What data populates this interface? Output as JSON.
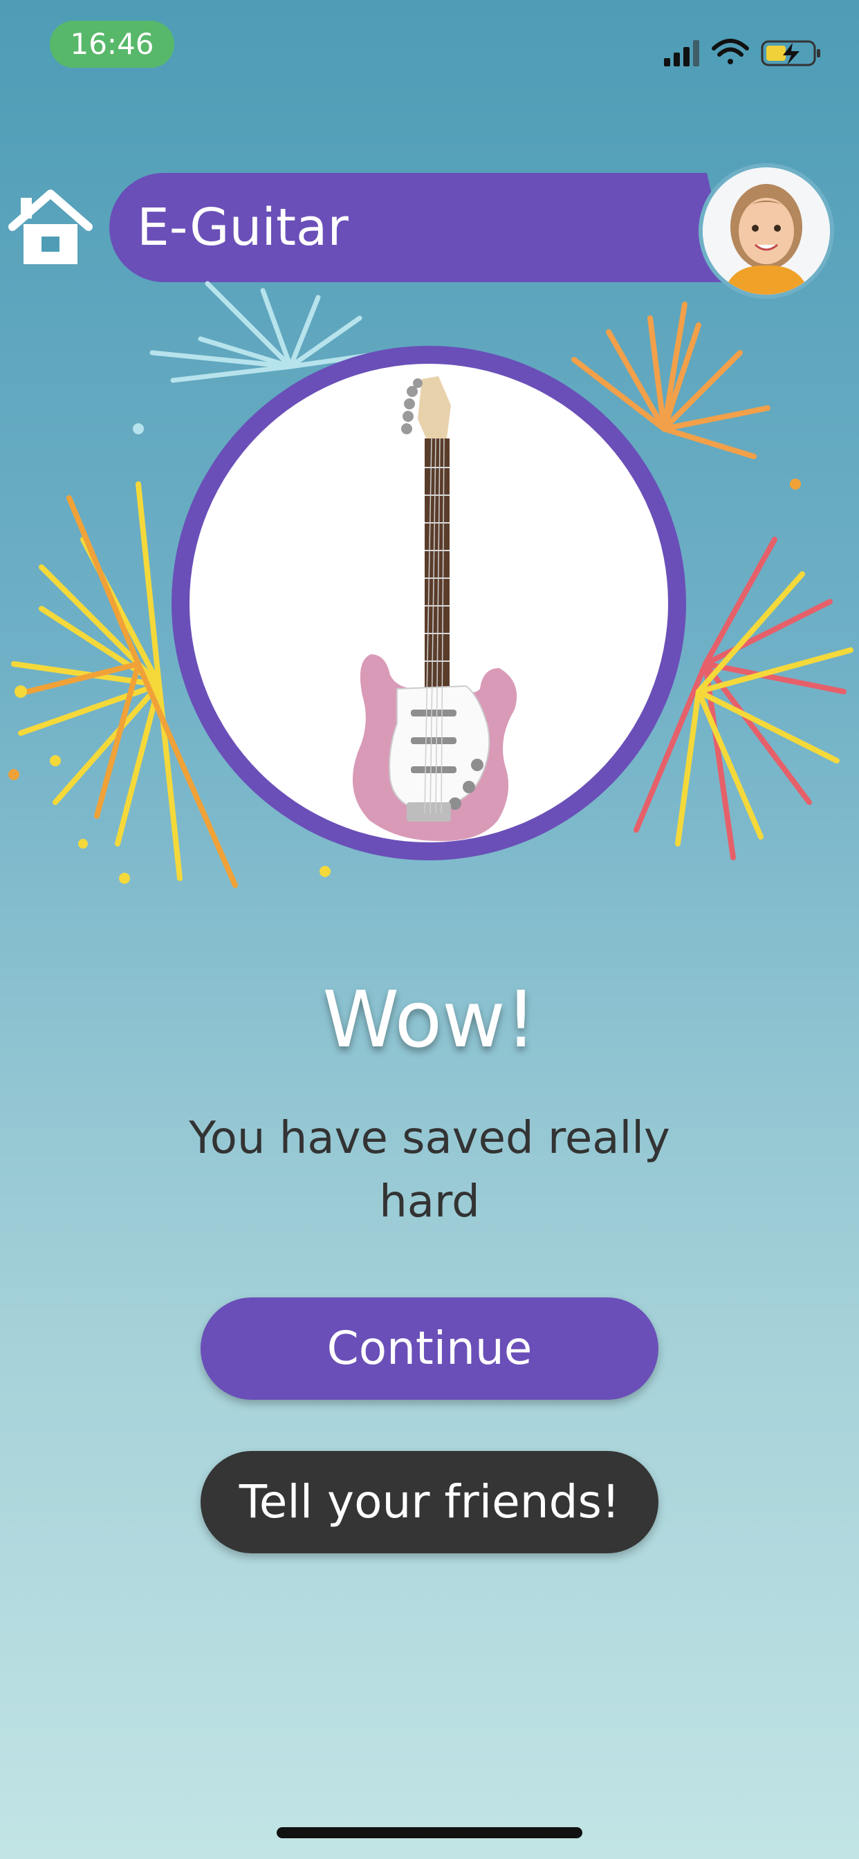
{
  "status_bar": {
    "time": "16:46",
    "icons": [
      "signal-icon",
      "wifi-icon",
      "battery-charging-icon"
    ]
  },
  "header": {
    "home_icon": "home-icon",
    "title": "E-Guitar",
    "avatar": "profile-avatar"
  },
  "product": {
    "image": "pink-electric-guitar"
  },
  "celebration": {
    "headline": "Wow!",
    "message": "You have saved really hard"
  },
  "actions": {
    "continue_label": "Continue",
    "share_label": "Tell your friends!"
  },
  "colors": {
    "primary": "#6a4fb8",
    "dark_button": "#353535",
    "time_pill": "#58b86a"
  }
}
